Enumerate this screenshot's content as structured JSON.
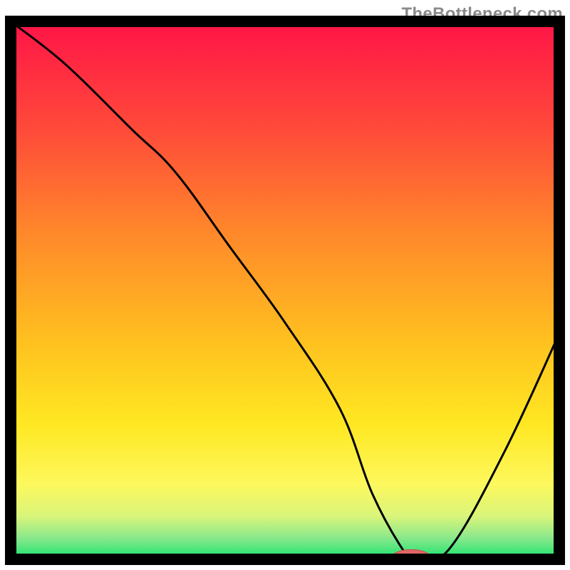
{
  "watermark": {
    "text": "TheBottleneck.com"
  },
  "colors": {
    "frame": "#000000",
    "curve": "#000000",
    "marker_fill": "#e06666",
    "marker_stroke": "#c94f4f",
    "gradient_stops": [
      {
        "offset": 0.0,
        "color": "#ff1447"
      },
      {
        "offset": 0.2,
        "color": "#ff4a3a"
      },
      {
        "offset": 0.4,
        "color": "#ff8a2a"
      },
      {
        "offset": 0.6,
        "color": "#ffc21f"
      },
      {
        "offset": 0.75,
        "color": "#ffe823"
      },
      {
        "offset": 0.86,
        "color": "#fdf85d"
      },
      {
        "offset": 0.92,
        "color": "#d9f57a"
      },
      {
        "offset": 0.96,
        "color": "#8be88c"
      },
      {
        "offset": 1.0,
        "color": "#17e36e"
      }
    ]
  },
  "chart_data": {
    "type": "line",
    "title": "",
    "xlabel": "",
    "ylabel": "",
    "xlim": [
      0,
      100
    ],
    "ylim": [
      0,
      100
    ],
    "series": [
      {
        "name": "bottleneck-curve",
        "x": [
          0,
          10,
          22,
          30,
          40,
          50,
          60,
          66,
          72,
          74,
          80,
          90,
          100
        ],
        "y": [
          100,
          92,
          80,
          72,
          58,
          44,
          28,
          12,
          1,
          0,
          2,
          20,
          42
        ]
      }
    ],
    "optimum_marker": {
      "x": 73,
      "y": 0.5,
      "rx": 3.4,
      "ry": 1.3
    }
  }
}
